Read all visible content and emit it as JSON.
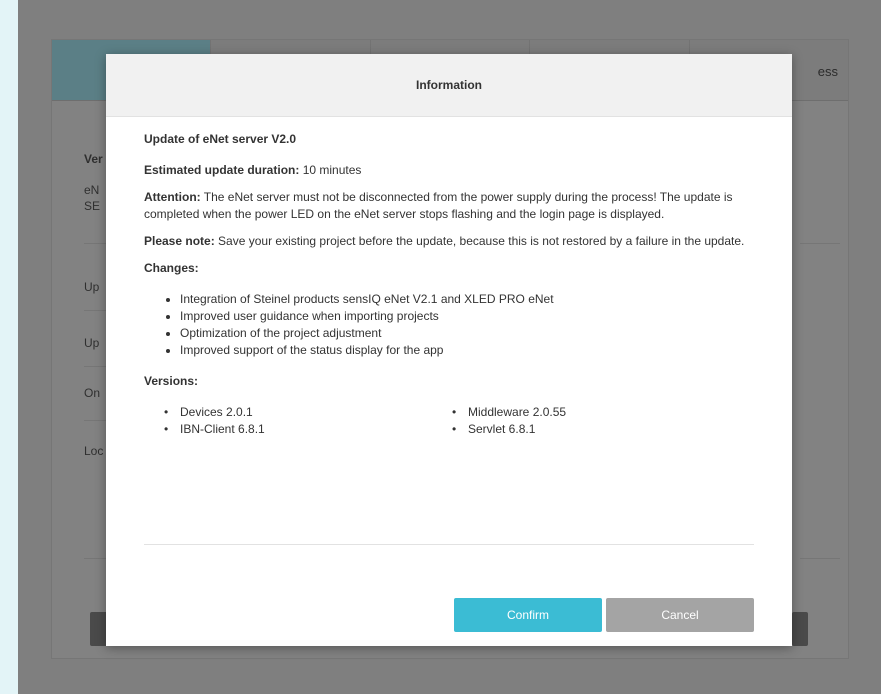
{
  "background": {
    "tab_partial_label": "ess",
    "rows": [
      {
        "text": "Ver",
        "bold": true
      },
      {
        "text": "eN",
        "bold": false
      },
      {
        "text": "SE",
        "bold": false
      },
      {
        "text": "Up",
        "bold": false
      },
      {
        "text": "Up",
        "bold": false
      },
      {
        "text": "On",
        "bold": false
      },
      {
        "text": "Loc",
        "bold": false
      }
    ]
  },
  "modal": {
    "title": "Information",
    "update_title": "Update of eNet server V2.0",
    "duration_label": "Estimated update duration:",
    "duration_value": "10 minutes",
    "attention_label": "Attention:",
    "attention_text": "The eNet server must not be disconnected from the power supply during the process! The update is completed when the power LED on the eNet server stops flashing and the login page is displayed.",
    "note_label": "Please note:",
    "note_text": "Save your existing project before the update, because this is not restored by a failure in the update.",
    "changes_label": "Changes:",
    "changes": [
      "Integration of Steinel products sensIQ eNet V2.1 and XLED PRO eNet",
      "Improved user guidance when importing projects",
      "Optimization of the project adjustment",
      "Improved support of the status display for the app"
    ],
    "versions_label": "Versions:",
    "versions": [
      "Devices 2.0.1",
      "Middleware 2.0.55",
      "IBN-Client 6.8.1",
      "Servlet 6.8.1"
    ],
    "confirm_label": "Confirm",
    "cancel_label": "Cancel"
  },
  "colors": {
    "confirm": "#3bbcd4",
    "cancel": "#a4a4a4",
    "active_tab": "#5b7f86"
  }
}
